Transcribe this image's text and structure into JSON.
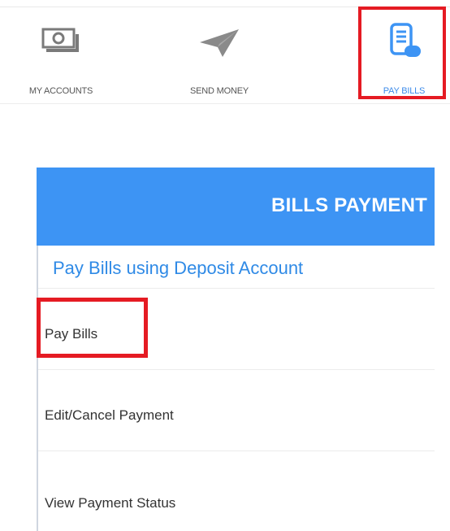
{
  "nav": {
    "items": [
      {
        "label": "MY ACCOUNTS",
        "icon": "banknote-icon"
      },
      {
        "label": "SEND MONEY",
        "icon": "paper-plane-icon"
      },
      {
        "label": "PAY BILLS",
        "icon": "bill-receipt-icon"
      }
    ],
    "active_label_color": "#3d8bea"
  },
  "bills_payment": {
    "title": "BILLS PAYMENT",
    "subtitle": "Pay Bills using Deposit Account",
    "menu": [
      {
        "label": "Pay Bills"
      },
      {
        "label": "Edit/Cancel Payment"
      },
      {
        "label": "View Payment Status"
      }
    ]
  },
  "colors": {
    "header_blue": "#3d94f4",
    "highlight_red": "#e51b23",
    "link_blue": "#2f8ae6",
    "icon_gray": "#7a7a7a"
  }
}
